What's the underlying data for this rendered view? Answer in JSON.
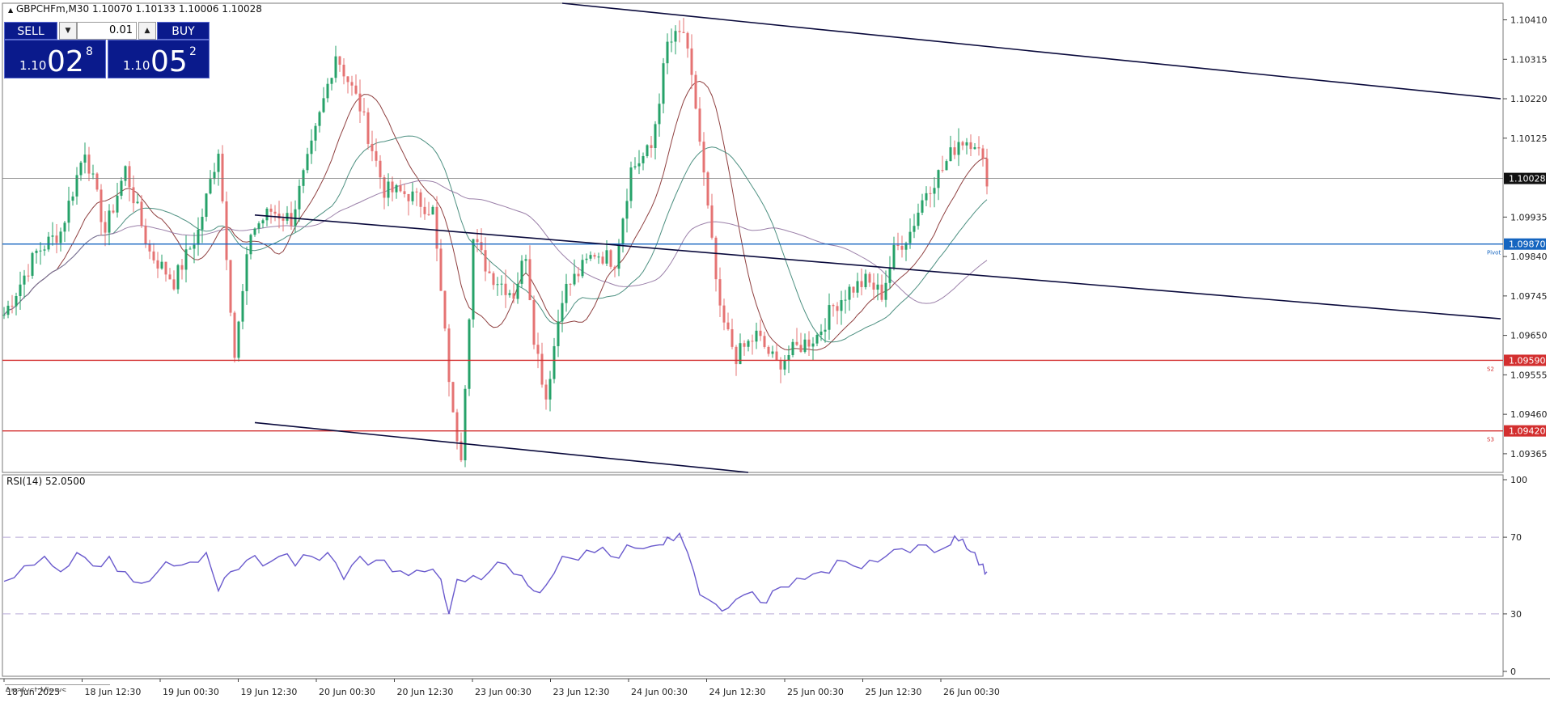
{
  "header": {
    "symbol_line": "GBPCHFm,M30  1.10070 1.10133 1.10006 1.10028",
    "triangle": "▲"
  },
  "trade_panel": {
    "sell_label": "SELL",
    "buy_label": "BUY",
    "lot_value": "0.01",
    "sell_price_small": "1.10",
    "sell_price_big": "02",
    "sell_price_sup": "8",
    "buy_price_small": "1.10",
    "buy_price_big": "05",
    "buy_price_sup": "2",
    "down_icon": "chevron-down-icon",
    "up_icon": "chevron-up-icon"
  },
  "rsi": {
    "title": "RSI(14) 52.0500"
  },
  "bottom_tab": {
    "label": "Analyst Views"
  },
  "colors": {
    "bull": "#26a269",
    "bear": "#e57373",
    "pivot": "#1565c0",
    "support": "#d32f2f",
    "channel": "#0a0a3c",
    "rsi_line": "#6a5acd",
    "ma_fast": "#7b1f1f",
    "ma_mid": "#2e7d6b",
    "ma_slow": "#8a6a9a"
  },
  "chart_data": [
    {
      "type": "candlestick",
      "symbol": "GBPCHFm",
      "timeframe": "M30",
      "ohlc_last": {
        "open": 1.1007,
        "high": 1.10133,
        "low": 1.10006,
        "close": 1.10028
      },
      "y_ticks": [
        1.1041,
        1.10315,
        1.1022,
        1.10125,
        1.09935,
        1.0984,
        1.09745,
        1.0965,
        1.09555,
        1.0946,
        1.09365
      ],
      "ylim": [
        1.0932,
        1.1045
      ],
      "x_tick_labels": [
        "18 Jun 2025",
        "18 Jun 12:30",
        "19 Jun 00:30",
        "19 Jun 12:30",
        "20 Jun 00:30",
        "20 Jun 12:30",
        "23 Jun 00:30",
        "23 Jun 12:30",
        "24 Jun 00:30",
        "24 Jun 12:30",
        "25 Jun 00:30",
        "25 Jun 12:30",
        "26 Jun 00:30"
      ],
      "price_path": [
        [
          0,
          1.097
        ],
        [
          8,
          1.0985
        ],
        [
          14,
          1.099
        ],
        [
          20,
          1.101
        ],
        [
          25,
          1.099
        ],
        [
          30,
          1.1005
        ],
        [
          36,
          1.0985
        ],
        [
          42,
          1.0978
        ],
        [
          48,
          1.099
        ],
        [
          53,
          1.101
        ],
        [
          57,
          1.096
        ],
        [
          61,
          1.099
        ],
        [
          66,
          1.0995
        ],
        [
          71,
          1.0993
        ],
        [
          76,
          1.101
        ],
        [
          82,
          1.1033
        ],
        [
          88,
          1.102
        ],
        [
          94,
          1.1
        ],
        [
          100,
          1.0999
        ],
        [
          106,
          1.0995
        ],
        [
          111,
          1.0945
        ],
        [
          113,
          1.0937
        ],
        [
          116,
          1.0988
        ],
        [
          120,
          1.098
        ],
        [
          126,
          1.0975
        ],
        [
          129,
          1.0985
        ],
        [
          131,
          1.0965
        ],
        [
          134,
          1.095
        ],
        [
          138,
          1.0975
        ],
        [
          142,
          1.098
        ],
        [
          146,
          1.0985
        ],
        [
          151,
          1.0983
        ],
        [
          155,
          1.1005
        ],
        [
          160,
          1.101
        ],
        [
          164,
          1.1035
        ],
        [
          168,
          1.1038
        ],
        [
          171,
          1.102
        ],
        [
          174,
          1.0995
        ],
        [
          177,
          1.097
        ],
        [
          181,
          1.096
        ],
        [
          186,
          1.0965
        ],
        [
          191,
          1.0958
        ],
        [
          196,
          1.0962
        ],
        [
          201,
          1.0965
        ],
        [
          205,
          1.0972
        ],
        [
          209,
          1.0976
        ],
        [
          213,
          1.0978
        ],
        [
          217,
          1.0975
        ],
        [
          220,
          1.0985
        ],
        [
          224,
          1.099
        ],
        [
          228,
          1.1
        ],
        [
          232,
          1.1005
        ],
        [
          236,
          1.1012
        ],
        [
          240,
          1.1012
        ],
        [
          243,
          1.1003
        ]
      ],
      "moving_averages": [
        {
          "name": "MA fast",
          "color": "ma_fast"
        },
        {
          "name": "MA mid",
          "color": "ma_mid"
        },
        {
          "name": "MA slow",
          "color": "ma_slow"
        }
      ],
      "horizontal_levels": [
        {
          "price": 1.10028,
          "label": "1.10028",
          "tag": "",
          "style": "current"
        },
        {
          "price": 1.0987,
          "label": "1.09870",
          "tag": "Pivot",
          "style": "pivot"
        },
        {
          "price": 1.0959,
          "label": "1.09590",
          "tag": "S2",
          "style": "support"
        },
        {
          "price": 1.0942,
          "label": "1.09420",
          "tag": "S3",
          "style": "support"
        }
      ],
      "trend_lines": [
        {
          "from": [
            138,
            1.1045
          ],
          "to": [
            370,
            1.1022
          ]
        },
        {
          "from": [
            62,
            1.0994
          ],
          "to": [
            370,
            1.0969
          ]
        },
        {
          "from": [
            62,
            1.0944
          ],
          "to": [
            184,
            1.0932
          ]
        }
      ],
      "grid": false
    },
    {
      "type": "line",
      "name": "RSI(14)",
      "current": 52.05,
      "ylim": [
        0,
        100
      ],
      "y_ticks": [
        100,
        70,
        30,
        0
      ],
      "levels": [
        70,
        30
      ],
      "path": [
        [
          0,
          47
        ],
        [
          5,
          55
        ],
        [
          10,
          60
        ],
        [
          14,
          52
        ],
        [
          18,
          62
        ],
        [
          22,
          55
        ],
        [
          26,
          60
        ],
        [
          30,
          52
        ],
        [
          34,
          46
        ],
        [
          38,
          52
        ],
        [
          42,
          55
        ],
        [
          46,
          57
        ],
        [
          50,
          62
        ],
        [
          53,
          42
        ],
        [
          56,
          52
        ],
        [
          60,
          58
        ],
        [
          64,
          55
        ],
        [
          68,
          60
        ],
        [
          72,
          55
        ],
        [
          76,
          60
        ],
        [
          80,
          62
        ],
        [
          84,
          48
        ],
        [
          88,
          60
        ],
        [
          92,
          58
        ],
        [
          96,
          52
        ],
        [
          100,
          50
        ],
        [
          104,
          52
        ],
        [
          108,
          48
        ],
        [
          110,
          30
        ],
        [
          112,
          48
        ],
        [
          116,
          50
        ],
        [
          120,
          52
        ],
        [
          124,
          56
        ],
        [
          128,
          50
        ],
        [
          131,
          42
        ],
        [
          134,
          45
        ],
        [
          138,
          60
        ],
        [
          142,
          58
        ],
        [
          146,
          62
        ],
        [
          150,
          60
        ],
        [
          154,
          66
        ],
        [
          158,
          64
        ],
        [
          162,
          66
        ],
        [
          164,
          70
        ],
        [
          167,
          72
        ],
        [
          169,
          62
        ],
        [
          172,
          40
        ],
        [
          176,
          35
        ],
        [
          179,
          33
        ],
        [
          183,
          40
        ],
        [
          187,
          36
        ],
        [
          190,
          42
        ],
        [
          194,
          44
        ],
        [
          198,
          48
        ],
        [
          202,
          52
        ],
        [
          206,
          58
        ],
        [
          210,
          55
        ],
        [
          214,
          58
        ],
        [
          218,
          60
        ],
        [
          222,
          64
        ],
        [
          226,
          66
        ],
        [
          230,
          62
        ],
        [
          234,
          66
        ],
        [
          236,
          68
        ],
        [
          238,
          64
        ],
        [
          240,
          62
        ],
        [
          242,
          56
        ],
        [
          243,
          52
        ]
      ]
    }
  ]
}
